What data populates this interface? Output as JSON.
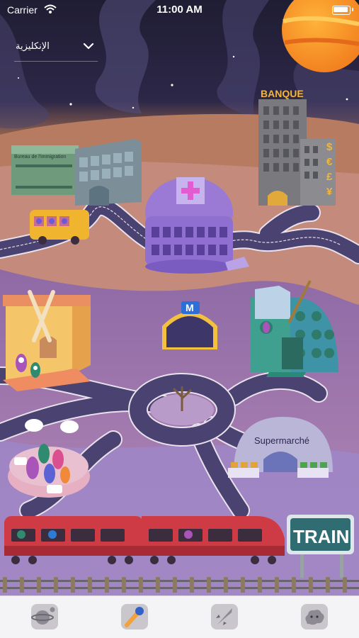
{
  "status_bar": {
    "carrier": "Carrier",
    "time": "11:00 AM"
  },
  "language_selector": {
    "value": "الإنكليزية"
  },
  "labels": {
    "immigration": "Bureau de l'immigration",
    "bank": "BANQUE",
    "bank_currency": [
      "$",
      "€",
      "£",
      "¥"
    ],
    "metro": "M",
    "supermarket": "Supermarché",
    "train": "TRAIN"
  },
  "tabs": [
    {
      "name": "planet-tab",
      "icon": "planet-icon"
    },
    {
      "name": "microphone-tab",
      "icon": "microphone-icon"
    },
    {
      "name": "rocket-tab",
      "icon": "rocket-icon"
    },
    {
      "name": "cloud-face-tab",
      "icon": "cloud-face-icon"
    }
  ],
  "colors": {
    "sky": "#201d36",
    "ground": "#b77b62",
    "road": "#4a4270",
    "train": "#cf3b45",
    "sign": "#2f6d73",
    "tabbar": "#f4f3f6"
  }
}
